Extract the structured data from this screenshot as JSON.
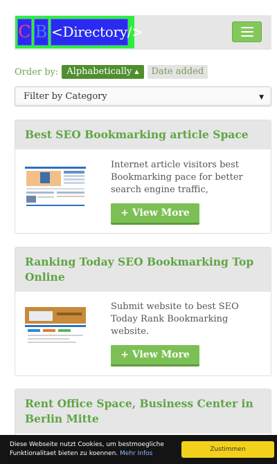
{
  "header": {
    "logo_c": "C",
    "logo_b": "B",
    "logo_directory": "<Directory/>"
  },
  "order": {
    "label": "Order by:",
    "alphabetically": "Alphabetically",
    "date_added": "Date added"
  },
  "filter": {
    "selected": "Filter by Category"
  },
  "cards": [
    {
      "title": "Best SEO Bookmarking article Space",
      "description": "Internet article visitors best Bookmarking pace for better search engine traffic,",
      "button": "+ View More"
    },
    {
      "title": "Ranking Today SEO Bookmarking Top Online",
      "description": "Submit website to best SEO Today Rank Bookmarking website.",
      "button": "+ View More"
    },
    {
      "title": "Rent Office Space, Business Center in Berlin Mitte"
    }
  ],
  "cookie": {
    "text": "Diese Webseite nutzt Cookies, um bestmoegliche Funktionalitaet bieten zu koennen.",
    "more_link": "Mehr Infos",
    "accept_button": "Zustimmen"
  }
}
